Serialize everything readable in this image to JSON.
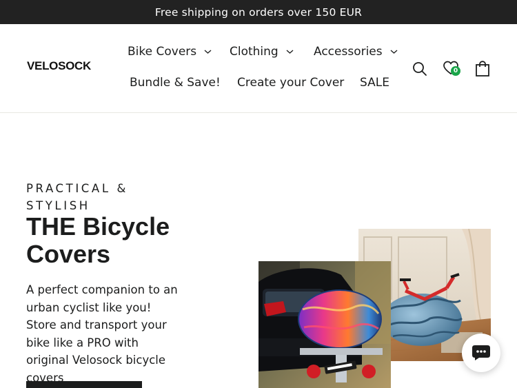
{
  "announcement": {
    "text": "Free shipping on orders over 150 EUR"
  },
  "header": {
    "logo": "VELOSOCK",
    "nav": [
      {
        "label": "Bike Covers",
        "has_dropdown": true
      },
      {
        "label": "Clothing",
        "has_dropdown": true
      },
      {
        "label": "Accessories",
        "has_dropdown": true
      },
      {
        "label": "Bundle & Save!",
        "has_dropdown": false
      },
      {
        "label": "Create your Cover",
        "has_dropdown": false
      },
      {
        "label": "SALE",
        "has_dropdown": false
      }
    ],
    "icons": [
      "search-icon",
      "wishlist-icon",
      "cart-icon"
    ],
    "wishlist_count": "0"
  },
  "hero": {
    "eyebrow": "PRACTICAL & STYLISH",
    "headline": "THE Bicycle Covers",
    "description": "A perfect companion to an urban cyclist like you! Store and transport your bike like a PRO with original Velosock bicycle covers",
    "images": [
      "bike-cover-on-car-rack-photo",
      "bike-cover-in-living-room-photo"
    ]
  },
  "colors": {
    "announcement_bg": "#222222",
    "text": "#1c1d1d",
    "badge": "#1aa549"
  }
}
